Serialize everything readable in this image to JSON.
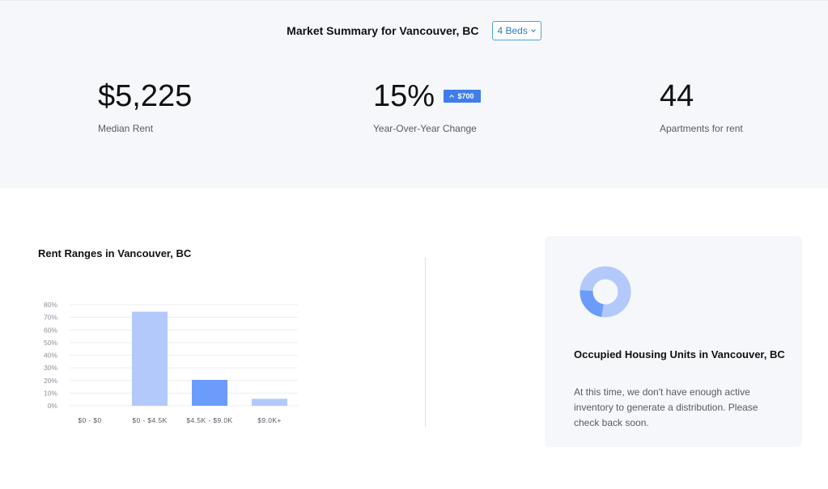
{
  "summary": {
    "title": "Market Summary for Vancouver, BC",
    "beds_selected": "4 Beds",
    "median_rent": {
      "value": "$5,225",
      "label": "Median Rent"
    },
    "yoy_change": {
      "value": "15%",
      "label": "Year-Over-Year Change",
      "badge": "$700",
      "direction": "up"
    },
    "apartments": {
      "value": "44",
      "label": "Apartments for rent"
    }
  },
  "rent_ranges": {
    "title": "Rent Ranges in Vancouver, BC"
  },
  "chart_data": {
    "type": "bar",
    "categories": [
      "$0 - $0",
      "$0 - $4.5K",
      "$4.5K - $9.0K",
      "$9.0K+"
    ],
    "values": [
      0,
      74.5,
      20.5,
      5.5
    ],
    "y_ticks": [
      "0%",
      "10%",
      "20%",
      "30%",
      "40%",
      "50%",
      "60%",
      "70%",
      "80%"
    ],
    "ylim": [
      0,
      80
    ],
    "grid": true,
    "colors": [
      "#b3c9fb",
      "#b3c9fb",
      "#6b9cfb",
      "#b3c9fb"
    ]
  },
  "occupied_units": {
    "title": "Occupied Housing Units in Vancouver, BC",
    "message": "At this time, we don't have enough active inventory to generate a distribution. Please check back soon.",
    "donut_colors": {
      "primary": "#b3c9fb",
      "secondary": "#6b9cfb"
    }
  }
}
